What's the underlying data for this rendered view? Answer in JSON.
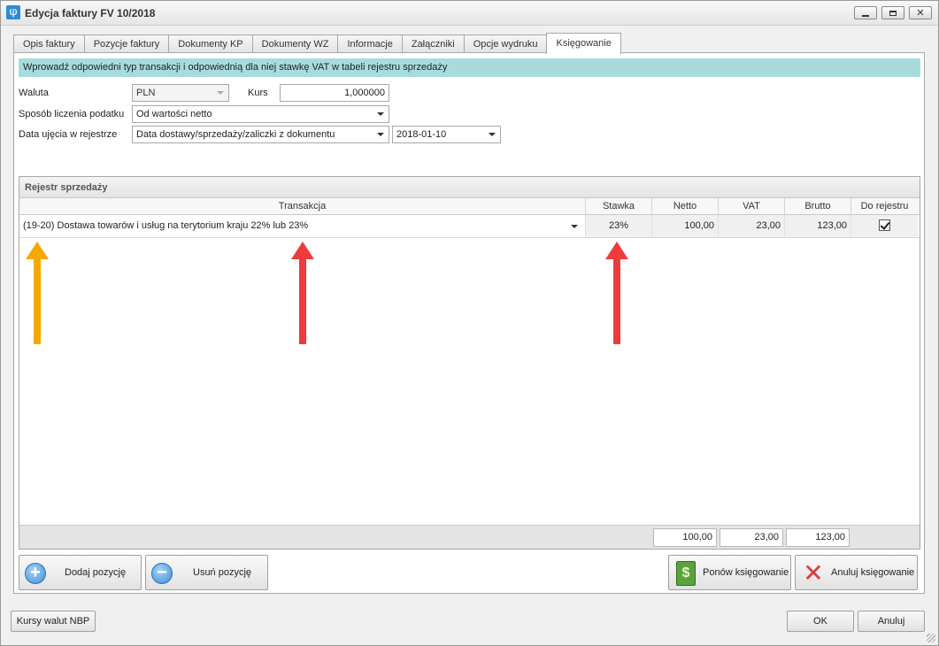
{
  "window": {
    "title": "Edycja faktury FV 10/2018",
    "icon": "phi-app-icon"
  },
  "tabs": [
    {
      "label": "Opis faktury",
      "active": false
    },
    {
      "label": "Pozycje faktury",
      "active": false
    },
    {
      "label": "Dokumenty KP",
      "active": false
    },
    {
      "label": "Dokumenty WZ",
      "active": false
    },
    {
      "label": "Informacje",
      "active": false
    },
    {
      "label": "Załączniki",
      "active": false
    },
    {
      "label": "Opcje wydruku",
      "active": false
    },
    {
      "label": "Księgowanie",
      "active": true
    }
  ],
  "info_message": "Wprowadź odpowiedni typ transakcji i odpowiednią dla niej stawkę VAT w tabeli rejestru sprzedaży",
  "form": {
    "currency_label": "Waluta",
    "currency_value": "PLN",
    "rate_label": "Kurs",
    "rate_value": "1,000000",
    "tax_method_label": "Sposób liczenia podatku",
    "tax_method_value": "Od wartości netto",
    "register_date_label": "Data ujęcia w rejestrze",
    "register_date_source": "Data dostawy/sprzedaży/zaliczki z dokumentu",
    "register_date_value": "2018-01-10"
  },
  "register": {
    "caption": "Rejestr sprzedaży",
    "columns": [
      "Transakcja",
      "Stawka",
      "Netto",
      "VAT",
      "Brutto",
      "Do rejestru"
    ],
    "rows": [
      {
        "transaction": "(19-20) Dostawa towarów i usług na terytorium kraju 22% lub 23%",
        "rate": "23%",
        "net": "100,00",
        "vat": "23,00",
        "gross": "123,00",
        "in_register": true
      }
    ],
    "totals": {
      "net": "100,00",
      "vat": "23,00",
      "gross": "123,00"
    }
  },
  "buttons": {
    "add_item": "Dodaj pozycję",
    "remove_item": "Usuń pozycję",
    "repost": "Ponów księgowanie",
    "cancel_posting": "Anuluj księgowanie",
    "nbp_rates": "Kursy walut NBP",
    "ok": "OK",
    "cancel": "Anuluj"
  },
  "annotation_colors": {
    "orange_arrow": "#f5a800",
    "red_arrow": "#ee3b3b"
  }
}
